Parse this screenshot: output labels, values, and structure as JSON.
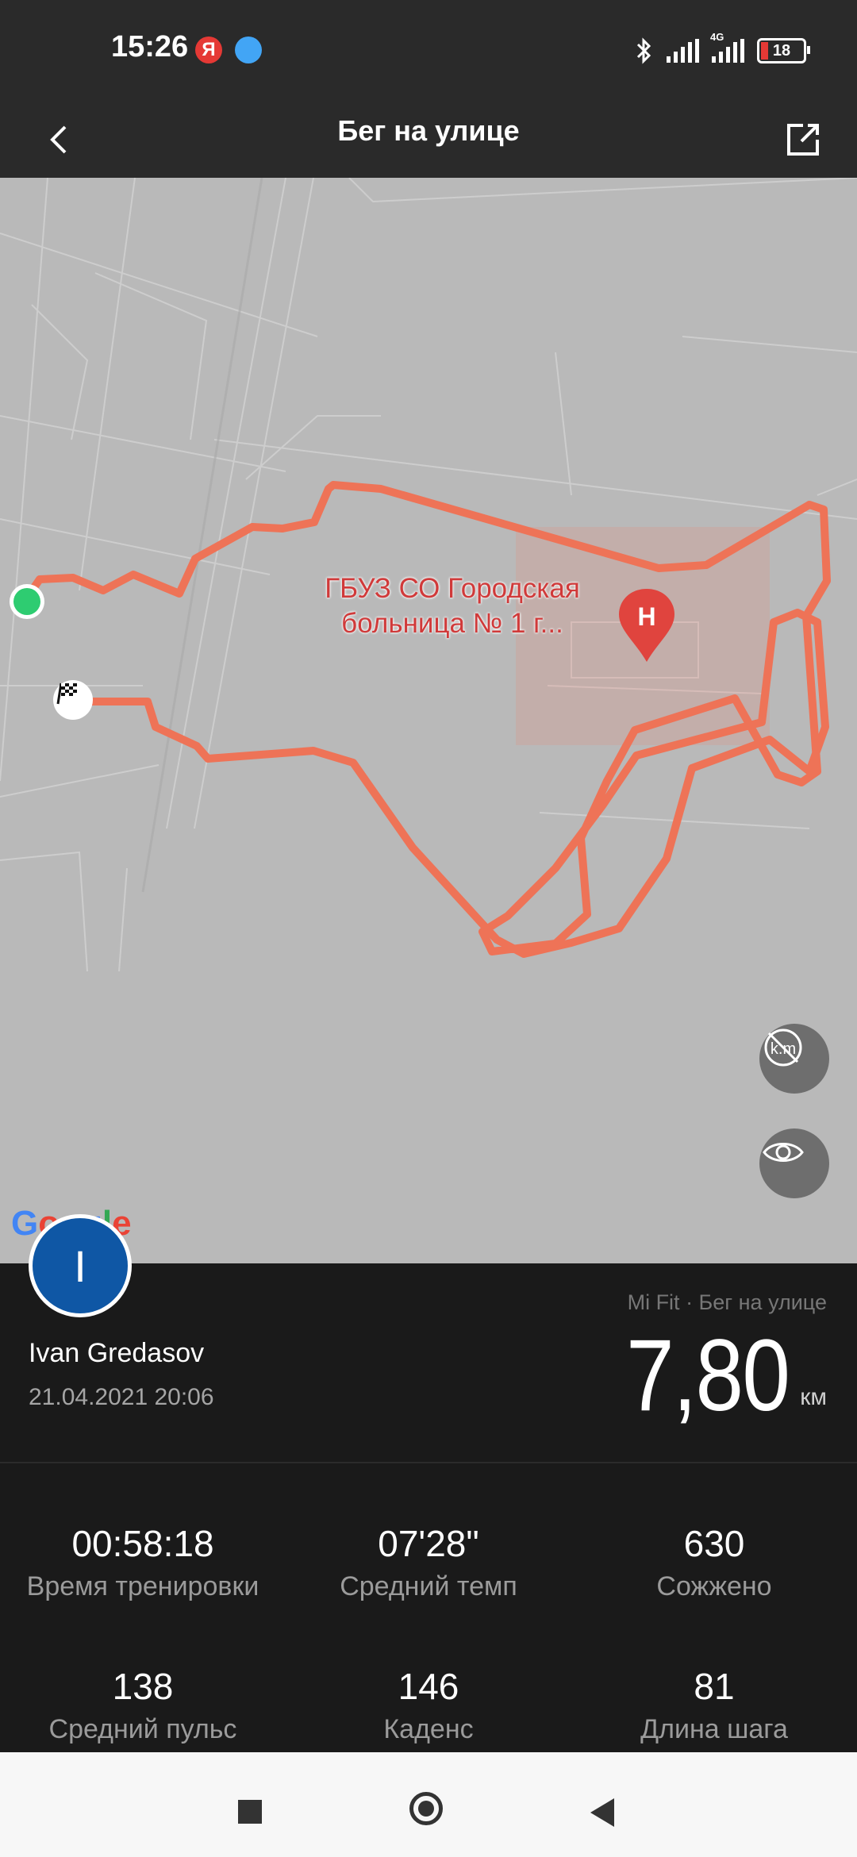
{
  "status_bar": {
    "time": "15:26",
    "notification_icons": [
      "yandex-icon",
      "heart-bubble-icon"
    ],
    "right_icons": [
      "bluetooth-icon",
      "signal-icon",
      "signal-4g-icon",
      "battery-icon"
    ],
    "network_label": "4G",
    "battery_level": "18"
  },
  "header": {
    "title": "Бег на улице",
    "back_icon": "chevron-left-icon",
    "share_icon": "share-export-icon"
  },
  "map": {
    "poi_label_line1": "ГБУЗ СО Городская",
    "poi_label_line2": "больница № 1 г...",
    "poi_icon_letter": "H",
    "route_color": "#ee7357",
    "start_marker_color": "#2ecc71",
    "finish_icon": "checkered-flag-icon",
    "buttons": [
      "km-markers-toggle-icon",
      "eye-icon"
    ],
    "attribution": "Google"
  },
  "summary": {
    "avatar_letter": "I",
    "user_name": "Ivan Gredasov",
    "date_time": "21.04.2021 20:06",
    "source": "Mi Fit · Бег на улице",
    "distance": "7,80",
    "distance_unit": "км"
  },
  "stats": [
    {
      "value": "00:58:18",
      "label": "Время тренировки"
    },
    {
      "value": "07'28\"",
      "label": "Средний темп"
    },
    {
      "value": "630",
      "label": "Сожжено"
    },
    {
      "value": "138",
      "label": "Средний пульс"
    },
    {
      "value": "146",
      "label": "Каденс"
    },
    {
      "value": "81",
      "label": "Длина шага"
    }
  ],
  "nav_bar": [
    "recents-square-icon",
    "home-circle-icon",
    "back-triangle-icon"
  ]
}
